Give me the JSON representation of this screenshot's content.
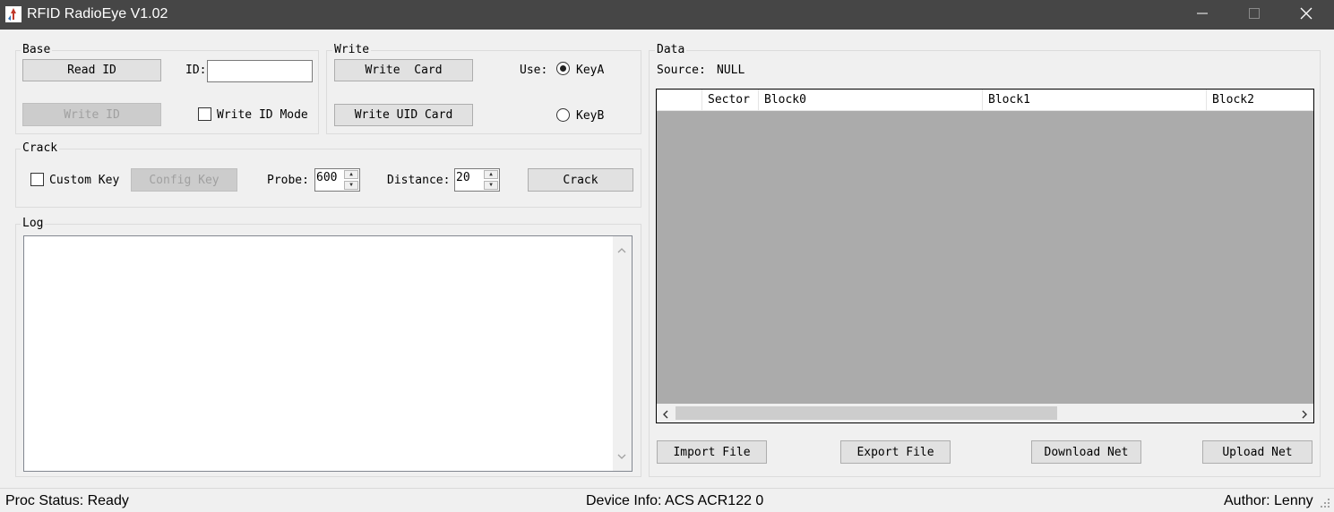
{
  "window": {
    "title": "RFID RadioEye V1.02"
  },
  "base": {
    "label": "Base",
    "read_id_label": "Read ID",
    "id_label": "ID:",
    "id_value": "",
    "write_id_label": "Write ID",
    "write_id_mode_label": "Write ID Mode"
  },
  "write": {
    "label": "Write",
    "write_card_label": "Write  Card",
    "write_uid_card_label": "Write UID Card",
    "use_label": "Use:",
    "keya_label": "KeyA",
    "keyb_label": "KeyB",
    "selected_key": "KeyA"
  },
  "crack": {
    "label": "Crack",
    "custom_key_label": "Custom Key",
    "config_key_label": "Config Key",
    "probe_label": "Probe:",
    "probe_value": "600",
    "distance_label": "Distance:",
    "distance_value": "20",
    "crack_label": "Crack"
  },
  "log": {
    "label": "Log"
  },
  "data": {
    "label": "Data",
    "source_label": "Source:",
    "source_value": "NULL",
    "columns": [
      "",
      "Sector",
      "Block0",
      "Block1",
      "Block2"
    ],
    "import_label": "Import File",
    "export_label": "Export File",
    "download_label": "Download Net",
    "upload_label": "Upload Net"
  },
  "status": {
    "proc": "Proc Status: Ready",
    "device": "Device Info: ACS ACR122 0",
    "author": "Author: Lenny"
  },
  "icons": {
    "minimize": "minimize-icon",
    "maximize": "maximize-icon",
    "close": "close-icon",
    "scroll_up": "scroll-up-arrow-icon",
    "scroll_down": "scroll-down-arrow-icon",
    "scroll_left": "scroll-left-arrow-icon",
    "scroll_right": "scroll-right-arrow-icon",
    "resize_grip": "resize-grip-icon"
  },
  "colors": {
    "titlebar": "#464646",
    "table_background": "#ababab",
    "window_background": "#f0f0f0"
  }
}
